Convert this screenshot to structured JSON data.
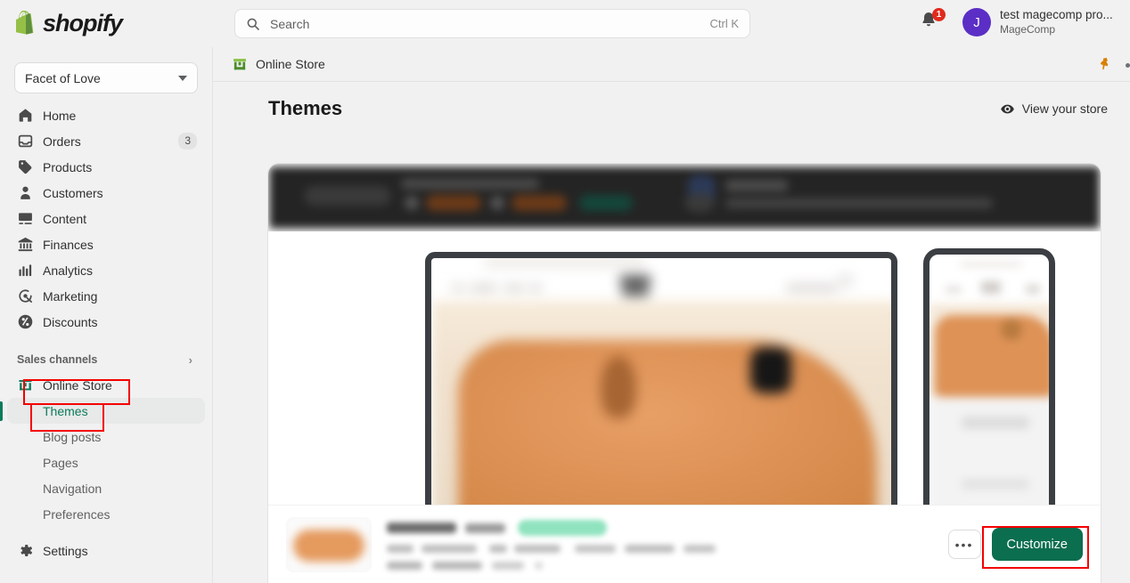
{
  "brand": {
    "name": "shopify",
    "logo_icon": "shopify-bag-icon"
  },
  "topbar": {
    "search": {
      "placeholder": "Search",
      "shortcut": "Ctrl K",
      "icon": "search-icon"
    },
    "notifications": {
      "icon": "bell-icon",
      "count": "1"
    },
    "account": {
      "initial": "J",
      "name": "test magecomp pro...",
      "org": "MageComp"
    }
  },
  "sidebar": {
    "store_switcher": {
      "label": "Facet of Love",
      "icon": "chevron-down-icon"
    },
    "items": [
      {
        "label": "Home",
        "icon": "home-icon",
        "badge": ""
      },
      {
        "label": "Orders",
        "icon": "orders-icon",
        "badge": "3"
      },
      {
        "label": "Products",
        "icon": "products-tag-icon",
        "badge": ""
      },
      {
        "label": "Customers",
        "icon": "customers-person-icon",
        "badge": ""
      },
      {
        "label": "Content",
        "icon": "content-image-icon",
        "badge": ""
      },
      {
        "label": "Finances",
        "icon": "finances-bank-icon",
        "badge": ""
      },
      {
        "label": "Analytics",
        "icon": "analytics-bars-icon",
        "badge": ""
      },
      {
        "label": "Marketing",
        "icon": "marketing-megaphone-icon",
        "badge": ""
      },
      {
        "label": "Discounts",
        "icon": "discounts-percent-icon",
        "badge": ""
      }
    ],
    "sales_channels": {
      "label": "Sales channels",
      "chevron_icon": "chevron-right-icon"
    },
    "online_store": {
      "label": "Online Store",
      "icon": "storefront-icon"
    },
    "sub_items": [
      {
        "label": "Themes",
        "active": true
      },
      {
        "label": "Blog posts",
        "active": false
      },
      {
        "label": "Pages",
        "active": false
      },
      {
        "label": "Navigation",
        "active": false
      },
      {
        "label": "Preferences",
        "active": false
      }
    ],
    "settings": {
      "label": "Settings",
      "icon": "gear-icon"
    }
  },
  "breadcrumb": {
    "label": "Online Store",
    "icon": "storefront-green-icon",
    "pin_icon": "pin-icon"
  },
  "page": {
    "title": "Themes",
    "view_store": {
      "label": "View your store",
      "icon": "eye-icon"
    }
  },
  "theme_card": {
    "announcement_strip": {
      "blurred": true
    },
    "desktop_preview": {
      "blurred": true,
      "device": "desktop"
    },
    "mobile_preview": {
      "blurred": true,
      "device": "mobile"
    },
    "thumbnail": {
      "blurred": true
    },
    "name": {
      "blurred": true
    },
    "badge": {
      "blurred": true,
      "color": "#8fe3bf"
    },
    "detail_lines": {
      "blurred": true
    },
    "actions": {
      "more_label": "•••",
      "customize_label": "Customize",
      "customize_color": "#0b6e4f"
    }
  },
  "annotations": {
    "color": "#f40000",
    "targets": [
      "online-store-nav-item",
      "themes-nav-item",
      "customize-button"
    ]
  }
}
